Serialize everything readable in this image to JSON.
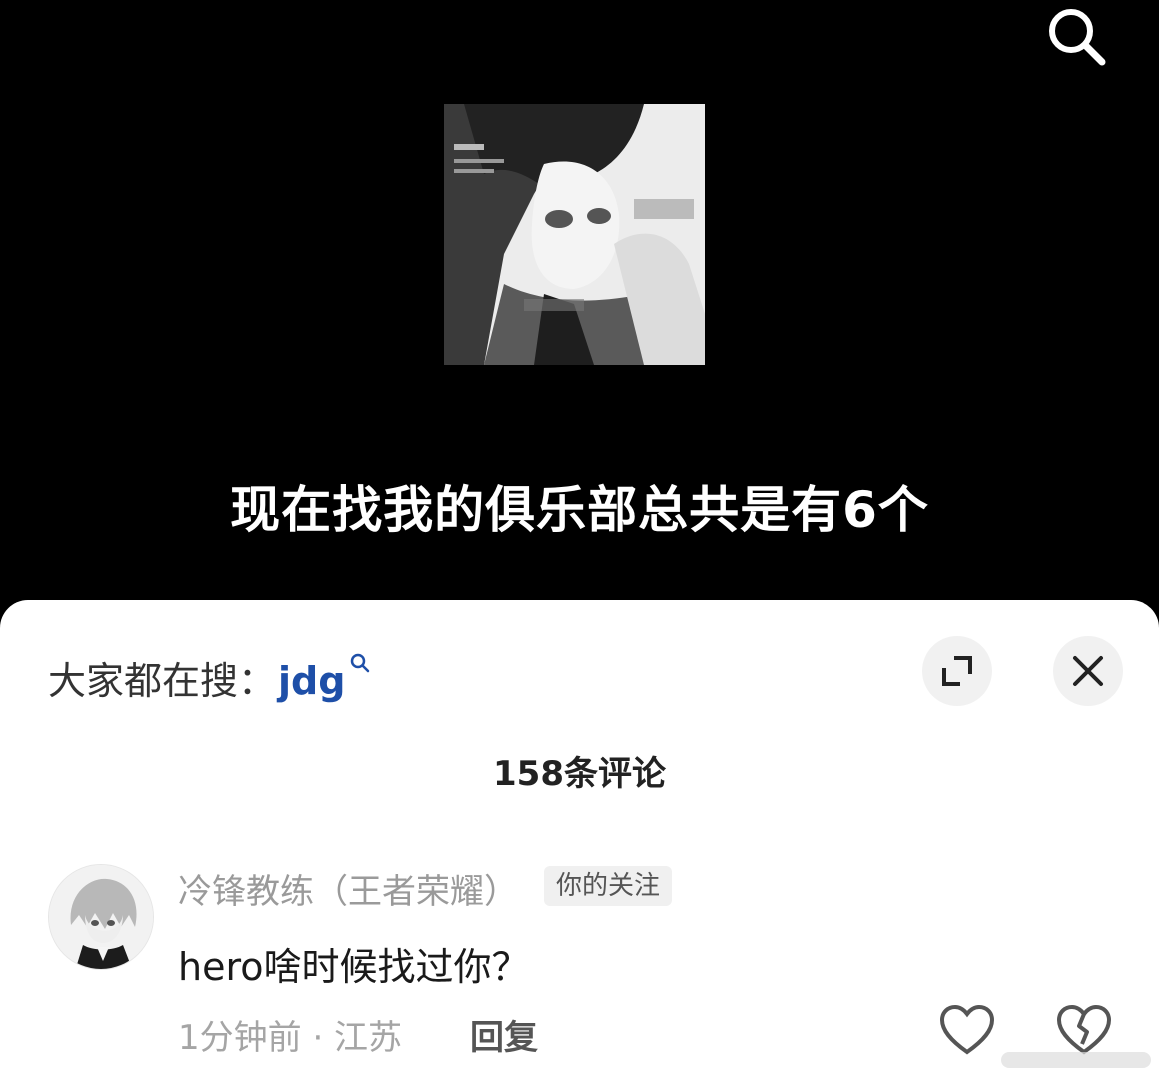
{
  "video": {
    "caption": "现在找我的俱乐部总共是有6个",
    "search_icon": "search-icon",
    "cover": "anime-artwork-cover"
  },
  "sheet": {
    "trending_prefix": "大家都在搜：",
    "trending_keyword": "jdg",
    "trending_icon": "search-small-icon",
    "expand_icon": "expand-icon",
    "close_icon": "close-icon",
    "comment_count": "158条评论"
  },
  "comments": [
    {
      "username": "冷锋教练（王者荣耀）",
      "badge": "你的关注",
      "text": "hero啥时候找过你？",
      "meta": "1分钟前 · 江苏",
      "reply_label": "回复",
      "like_icon": "heart-icon",
      "dislike_icon": "broken-heart-icon"
    }
  ],
  "colors": {
    "background": "#000000",
    "sheet": "#ffffff",
    "keyword": "#1e4fa8",
    "muted": "#9a9a9a"
  }
}
